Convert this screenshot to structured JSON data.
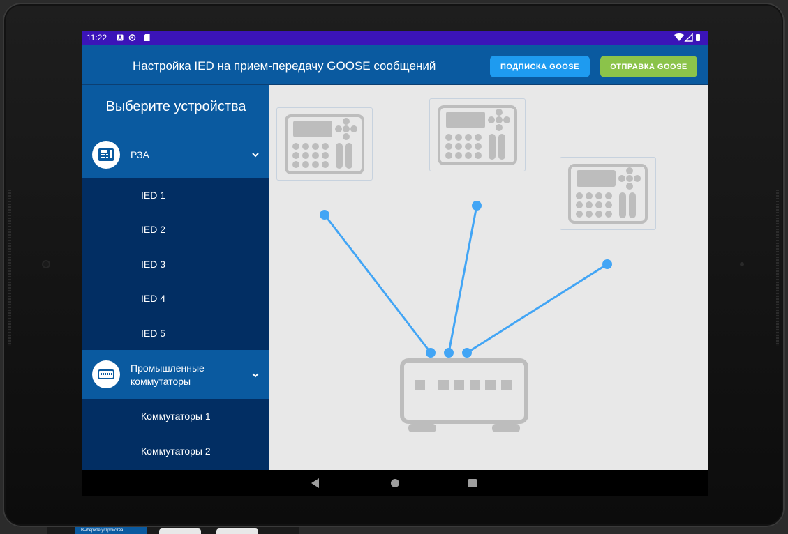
{
  "status_bar": {
    "time": "11:22"
  },
  "app_bar": {
    "title": "Настройка IED на прием-передачу GOOSE сообщений",
    "subscribe_button": "ПОДПИСКА GOOSE",
    "send_button": "ОТПРАВКА GOOSE"
  },
  "sidebar": {
    "heading": "Выберите устройства",
    "groups": [
      {
        "label": "РЗА",
        "icon": "relay-protection-icon",
        "expanded": true,
        "items": [
          "IED 1",
          "IED 2",
          "IED 3",
          "IED 4",
          "IED 5"
        ]
      },
      {
        "label_line1": "Промышленные",
        "label_line2": "коммутаторы",
        "icon": "network-switch-icon",
        "expanded": true,
        "items": [
          "Коммутаторы 1",
          "Коммутаторы 2"
        ]
      }
    ]
  },
  "canvas": {
    "devices": [
      "ied-device",
      "ied-device",
      "ied-device"
    ],
    "switch": "network-switch",
    "connection_color": "#42a5f5"
  },
  "footer_thumbnail": {
    "label": "Выберите устройства"
  },
  "colors": {
    "status_bar": "#3b14b8",
    "app_bar": "#0a5aa0",
    "sidebar_dark": "#022e63",
    "subscribe_button": "#1e9bf0",
    "send_button": "#8bc34a",
    "canvas_bg": "#e8e8e8",
    "device_gray": "#bdbdbd"
  }
}
